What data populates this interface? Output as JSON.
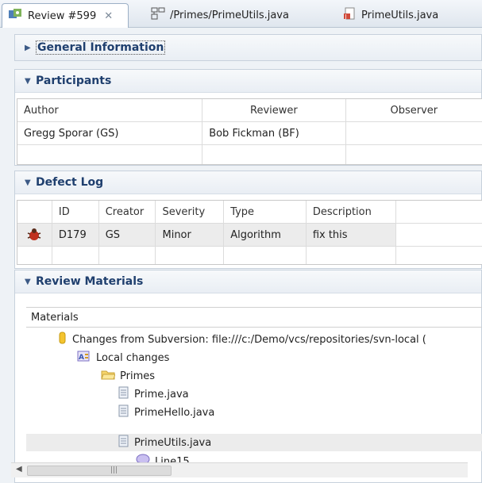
{
  "tabs": [
    {
      "label": "Review #599",
      "icon": "review-icon",
      "active": true,
      "close": "✕"
    },
    {
      "label": "/Primes/PrimeUtils.java",
      "icon": "compare-icon",
      "active": false
    },
    {
      "label": "PrimeUtils.java",
      "icon": "java-file-icon",
      "active": false
    }
  ],
  "sections": {
    "general": {
      "title": "General Information",
      "expanded": false
    },
    "participants": {
      "title": "Participants",
      "headers": [
        "Author",
        "Reviewer",
        "Observer"
      ],
      "rows": [
        [
          "Gregg Sporar (GS)",
          "Bob Fickman (BF)",
          ""
        ]
      ]
    },
    "defects": {
      "title": "Defect Log",
      "headers": [
        "ID",
        "Creator",
        "Severity",
        "Type",
        "Description"
      ],
      "rows": [
        {
          "id": "D179",
          "creator": "GS",
          "severity": "Minor",
          "type": "Algorithm",
          "description": "fix this",
          "icon": "bug-icon"
        }
      ]
    },
    "materials": {
      "title": "Review Materials",
      "header": "Materials",
      "tree": [
        {
          "label": "Changes from Subversion: file:///c:/Demo/vcs/repositories/svn-local (",
          "icon": "changeset-icon",
          "level": 0
        },
        {
          "label": "Local changes",
          "icon": "local-changes-icon",
          "level": 1
        },
        {
          "label": "Primes",
          "icon": "folder-icon",
          "level": 2
        },
        {
          "label": "Prime.java",
          "icon": "file-icon",
          "level": 3
        },
        {
          "label": "PrimeHello.java",
          "icon": "file-icon",
          "level": 3
        },
        {
          "label": "PrimeUtils.java",
          "icon": "file-icon",
          "level": 3,
          "selected": true
        },
        {
          "label": "Line15",
          "icon": "comment-icon",
          "level": 4
        }
      ]
    }
  },
  "colors": {
    "header_text": "#1f3f6e",
    "selection": "#ececec"
  }
}
